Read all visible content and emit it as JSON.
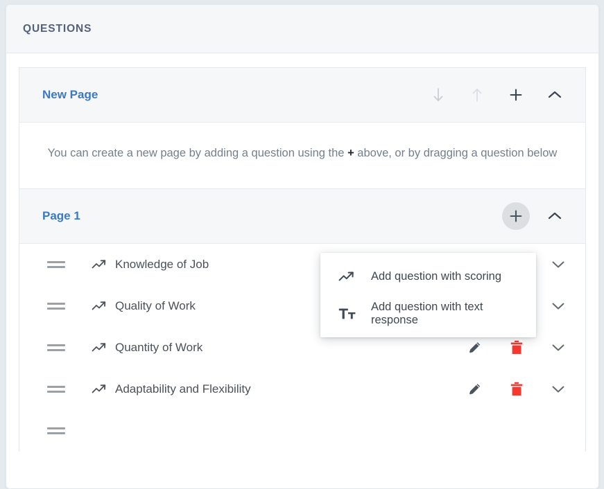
{
  "panel": {
    "title": "QUESTIONS"
  },
  "colors": {
    "page_background": "#e4eaee",
    "card_background": "#ffffff",
    "header_background": "#f5f7f9",
    "link_blue": "#3c79c4",
    "title_slate": "#53617a",
    "delete_red": "#f8372f",
    "edit_gray": "#4a545e",
    "muted_text": "#737f8c"
  },
  "pages": [
    {
      "name": "New Page",
      "description_before": "You can create a new page by adding a question using the",
      "description_plus": "+",
      "description_after": "above, or by dragging a question below",
      "actions": [
        {
          "name": "move-down-icon",
          "label": "Move page down"
        },
        {
          "name": "move-up-icon",
          "label": "Move page up"
        },
        {
          "name": "add-question-icon",
          "label": "Add question"
        },
        {
          "name": "collapse-icon",
          "label": "Collapse page"
        }
      ],
      "questions": []
    },
    {
      "name": "Page 1",
      "actions": [
        {
          "name": "add-question-icon",
          "label": "Add question"
        },
        {
          "name": "collapse-icon",
          "label": "Collapse page"
        }
      ],
      "questions": [
        {
          "label": "Knowledge of Job",
          "type_icon": "scoring-chart-icon",
          "actions_hidden": true
        },
        {
          "label": "Quality of Work",
          "type_icon": "scoring-chart-icon",
          "actions_hidden": true
        },
        {
          "label": "Quantity of Work",
          "type_icon": "scoring-chart-icon",
          "actions_hidden": false
        },
        {
          "label": "Adaptability and Flexibility",
          "type_icon": "scoring-chart-icon",
          "actions_hidden": false
        }
      ]
    }
  ],
  "dropdown": {
    "open": true,
    "items": [
      {
        "icon": "scoring-chart-icon",
        "label": "Add question with scoring"
      },
      {
        "icon": "text-response-icon",
        "label": "Add question with text response"
      }
    ]
  }
}
